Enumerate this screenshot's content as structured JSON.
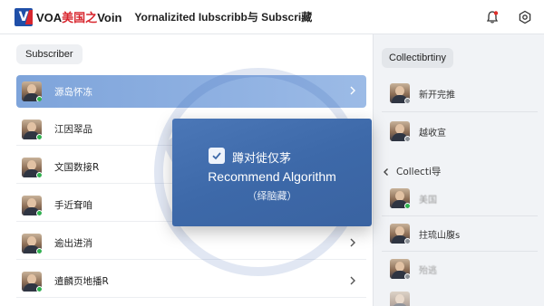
{
  "header": {
    "logo_prefix": "VOA",
    "logo_red": "美国之",
    "logo_suffix": "Voin",
    "title": "Yornalizited Iubscribb与 Subscri藏",
    "icons": [
      "bell-icon",
      "settings-icon"
    ],
    "notification_color": "#e0302b"
  },
  "left": {
    "section_label": "Subscriber",
    "items": [
      {
        "label": "源岛怀冻",
        "status": "online",
        "selected": true,
        "chevron": true
      },
      {
        "label": "江因翠品",
        "status": "online",
        "selected": false,
        "chevron": false
      },
      {
        "label": "文国数接R",
        "status": "online",
        "selected": false,
        "chevron": false
      },
      {
        "label": "手近耷咱",
        "status": "online",
        "selected": false,
        "chevron": false
      },
      {
        "label": "逾出进消",
        "status": "online",
        "selected": false,
        "chevron": true
      },
      {
        "label": "遣麟页地播R",
        "status": "online",
        "selected": false,
        "chevron": true
      }
    ]
  },
  "right": {
    "section_label": "Collectibrtiny",
    "items_top": [
      {
        "label": "新开完推",
        "status": "gray"
      },
      {
        "label": "越收宣",
        "status": "gray"
      }
    ],
    "collection_label": "Collecti导",
    "items_bottom": [
      {
        "label": "美国",
        "status": "online",
        "faded": true
      },
      {
        "label": "拄琉山腹s",
        "status": "gray",
        "faded": false
      },
      {
        "label": "殆逃",
        "status": "gray",
        "faded": true
      },
      {
        "label": "",
        "status": "gray",
        "faded": true
      }
    ]
  },
  "overlay": {
    "title": "蹲对徙仅茅",
    "main": "Recommend Algorithm",
    "sub": "（绎脑藏）",
    "checked": true,
    "accent": "#3d69a9"
  },
  "colors": {
    "selected_row": "#8fb1e2",
    "online": "#2fb350",
    "brand_blue": "#1f4fa8",
    "brand_red": "#d8262e"
  }
}
